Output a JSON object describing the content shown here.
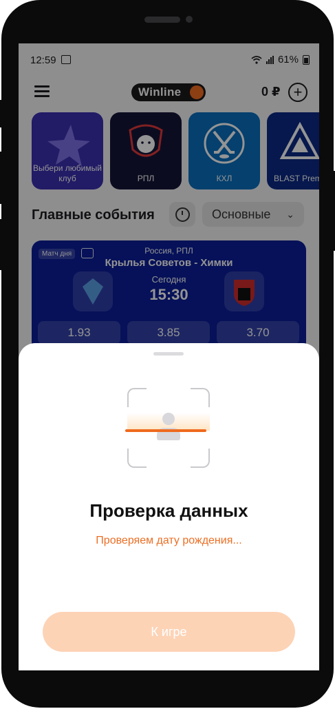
{
  "status_bar": {
    "time": "12:59",
    "battery": "61%"
  },
  "header": {
    "logo": "Winline",
    "balance": "0 ₽",
    "add_label": "+"
  },
  "tiles": [
    {
      "label": "Выбери любимый клуб"
    },
    {
      "label": "РПЛ"
    },
    {
      "label": "КХЛ"
    },
    {
      "label": "BLAST Prem"
    }
  ],
  "section": {
    "title": "Главные события",
    "filter": "Основные"
  },
  "match": {
    "tag": "Матч дня",
    "league": "Россия, РПЛ",
    "teams": "Крылья Советов - Химки",
    "day": "Сегодня",
    "time": "15:30",
    "odds": [
      "1.93",
      "3.85",
      "3.70"
    ]
  },
  "sheet": {
    "heading": "Проверка данных",
    "status": "Проверяем дату рождения...",
    "button": "К игре"
  },
  "colors": {
    "accent": "#ef6a1f",
    "button_disabled": "#fdd3b6",
    "match_bg": "#0b1e9a"
  },
  "icons": [
    "menu-icon",
    "plus-icon",
    "clock-icon",
    "chevron-down-icon",
    "tv-icon",
    "face-scan-icon"
  ]
}
